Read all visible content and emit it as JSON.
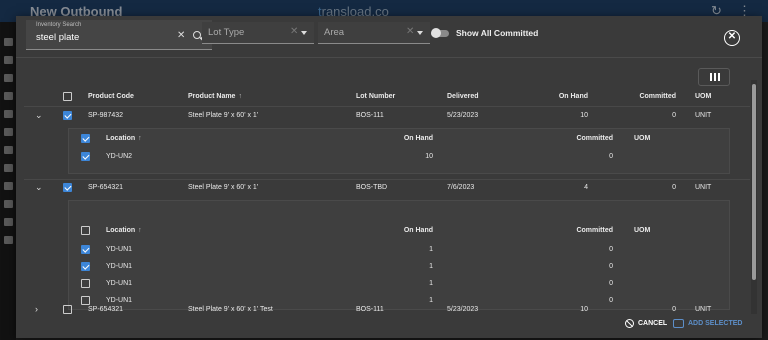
{
  "app": {
    "title": "New Outbound",
    "logo_text": "ransload.co",
    "logo_mark": "t",
    "refresh_icon": "refresh-icon",
    "more_icon": "more-vertical-icon"
  },
  "dialog": {
    "search": {
      "label": "Inventory Search",
      "value": "steel plate"
    },
    "lot_type": {
      "placeholder": "Lot Type"
    },
    "area": {
      "placeholder": "Area"
    },
    "toggle": {
      "label": "Show All Committed",
      "on": false
    },
    "close_icon": "close-circle-icon",
    "columns_icon": "view-columns-icon",
    "accent_color": "#3d86d8"
  },
  "table": {
    "headers": {
      "product_code": "Product Code",
      "product_name": "Product Name",
      "lot_number": "Lot Number",
      "delivered": "Delivered",
      "on_hand": "On Hand",
      "committed": "Committed",
      "uom": "UOM"
    },
    "sub_headers": {
      "location": "Location",
      "on_hand": "On Hand",
      "committed": "Committed",
      "uom": "UOM"
    },
    "rows": [
      {
        "code": "SP-987432",
        "name": "Steel Plate 9' x 60' x 1'",
        "lot": "BOS-111",
        "delivered": "5/23/2023",
        "on_hand": "10",
        "committed": "0",
        "uom": "UNIT",
        "checked": true,
        "expanded": true,
        "locations": [
          {
            "location": "YD-UN2",
            "on_hand": "10",
            "committed": "0",
            "checked": true
          }
        ]
      },
      {
        "code": "SP-654321",
        "name": "Steel Plate 9' x 60' x 1'",
        "lot": "BOS-TBD",
        "delivered": "7/6/2023",
        "on_hand": "4",
        "committed": "0",
        "uom": "UNIT",
        "checked": true,
        "expanded": true,
        "locations": [
          {
            "location": "YD-UN1",
            "on_hand": "1",
            "committed": "0",
            "checked": true
          },
          {
            "location": "YD-UN1",
            "on_hand": "1",
            "committed": "0",
            "checked": true
          },
          {
            "location": "YD-UN1",
            "on_hand": "1",
            "committed": "0",
            "checked": false
          },
          {
            "location": "YD-UN1",
            "on_hand": "1",
            "committed": "0",
            "checked": false
          }
        ]
      },
      {
        "code": "SP-654321",
        "name": "Steel Plate 9' x 60' x 1' Test",
        "lot": "BOS-111",
        "delivered": "5/23/2023",
        "on_hand": "10",
        "committed": "0",
        "uom": "UNIT",
        "checked": false,
        "expanded": false,
        "locations": []
      }
    ]
  },
  "footer": {
    "cancel_label": "CANCEL",
    "add_label": "ADD SELECTED",
    "cancel_icon": "cancel-icon",
    "add_icon": "add-selected-icon"
  }
}
